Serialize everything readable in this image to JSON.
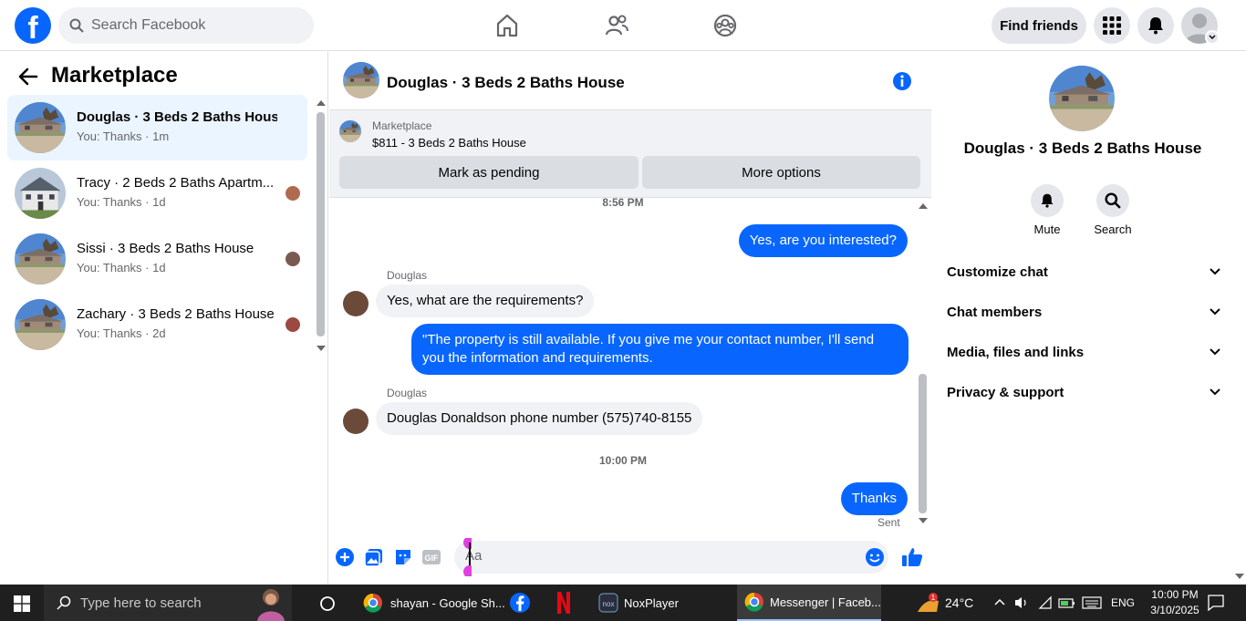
{
  "topbar": {
    "logo_letter": "f",
    "search_placeholder": "Search Facebook",
    "find_friends": "Find friends"
  },
  "left": {
    "title": "Marketplace",
    "conversations": [
      {
        "title": "Douglas · 3 Beds 2 Baths House",
        "sub": "You: Thanks · 1m",
        "active": true
      },
      {
        "title": "Tracy · 2 Beds 2 Baths Apartm...",
        "sub": "You: Thanks · 1d"
      },
      {
        "title": "Sissi · 3 Beds 2 Baths House",
        "sub": "You: Thanks · 1d"
      },
      {
        "title": "Zachary · 3 Beds 2 Baths House",
        "sub": "You: Thanks · 2d"
      }
    ]
  },
  "chat": {
    "title": "Douglas · 3 Beds 2 Baths House",
    "banner_label": "Marketplace",
    "banner_price": "$811 - 3 Beds 2 Baths House",
    "mark_pending": "Mark as pending",
    "more_options": "More options",
    "messages": {
      "time1": "8:56 PM",
      "out1": "Yes, are you interested?",
      "sender1": "Douglas",
      "in1": "Yes, what are the requirements?",
      "out2": "\"The property is still available. If you give me your contact number, I'll send you the information and requirements.",
      "sender2": "Douglas",
      "in2": "Douglas Donaldson phone number (575)740-8155",
      "time2": "10:00 PM",
      "out3": "Thanks",
      "status": "Sent"
    },
    "composer_placeholder": "Aa",
    "gif_label": "GIF"
  },
  "right": {
    "title": "Douglas · 3 Beds 2 Baths House",
    "mute": "Mute",
    "search": "Search",
    "rows": [
      "Customize chat",
      "Chat members",
      "Media, files and links",
      "Privacy & support"
    ]
  },
  "taskbar": {
    "search_placeholder": "Type here to search",
    "apps": {
      "chrome1": "shayan - Google Sh...",
      "nox": "NoxPlayer",
      "messenger": "Messenger | Faceb..."
    },
    "weather": "24°C",
    "weather_badge": "1",
    "lang": "ENG",
    "time": "10:00 PM",
    "date": "3/10/2025"
  },
  "colors": {
    "accent": "#0866ff",
    "bubble_in": "#f0f2f5",
    "active_conv": "#ebf5ff",
    "taskbar": "#1f1f1f"
  }
}
